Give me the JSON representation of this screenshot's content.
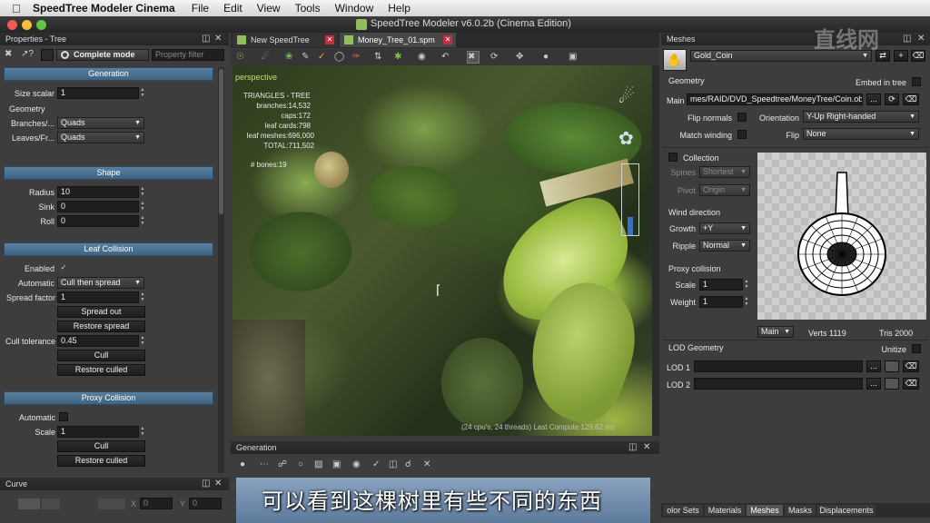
{
  "menubar": {
    "app_name": "SpeedTree Modeler Cinema",
    "items": [
      "File",
      "Edit",
      "View",
      "Tools",
      "Window",
      "Help"
    ]
  },
  "window": {
    "title": "SpeedTree Modeler v6.0.2b (Cinema Edition)"
  },
  "left_panel": {
    "title": "Properties - Tree",
    "mode": "Complete mode",
    "filter_placeholder": "Property filter",
    "generation": {
      "title": "Generation",
      "size_scalar_label": "Size scalar",
      "size_scalar": "1",
      "geometry_label": "Geometry",
      "branches_label": "Branches/...",
      "branches": "Quads",
      "leaves_label": "Leaves/Fr...",
      "leaves": "Quads"
    },
    "shape": {
      "title": "Shape",
      "radius_label": "Radius",
      "radius": "10",
      "sink_label": "Sink",
      "sink": "0",
      "roll_label": "Roll",
      "roll": "0"
    },
    "leaf_collision": {
      "title": "Leaf Collision",
      "enabled_label": "Enabled",
      "enabled": "✓",
      "automatic_label": "Automatic",
      "automatic": "Cull then spread",
      "spread_factor_label": "Spread factor",
      "spread_factor": "1",
      "spread_out": "Spread out",
      "restore_spread": "Restore spread",
      "cull_tolerance_label": "Cull tolerance",
      "cull_tolerance": "0.45",
      "cull": "Cull",
      "restore_culled": "Restore culled"
    },
    "proxy_collision": {
      "title": "Proxy Collision",
      "automatic_label": "Automatic",
      "scale_label": "Scale",
      "scale": "1",
      "cull": "Cull",
      "restore_culled": "Restore culled"
    },
    "curve": {
      "title": "Curve",
      "x_label": "X",
      "x": "0",
      "y_label": "Y",
      "y": "0"
    }
  },
  "center": {
    "tabs": [
      "New SpeedTree",
      "Money_Tree_01.spm"
    ],
    "viewport_label": "perspective",
    "stats": {
      "header": "TRIANGLES - TREE",
      "lines": [
        "branches:14,532",
        "caps:172",
        "leaf cards:798",
        "leaf meshes:696,000",
        "TOTAL:711,502"
      ],
      "bones": "# bones:19"
    },
    "status": "(24 cpu's, 24 threads) Last Compute 129.62 ms",
    "generation_panel_title": "Generation"
  },
  "right_panel": {
    "title": "Meshes",
    "mesh_name": "Gold_Coin",
    "geometry_label": "Geometry",
    "embed_label": "Embed in tree",
    "main_label": "Main",
    "main_path": "mes/RAID/DVD_Speedtree/MoneyTree/Coin.obj",
    "flip_normals_label": "Flip normals",
    "orientation_label": "Orientation",
    "orientation": "Y-Up Right-handed",
    "match_winding_label": "Match winding",
    "flip_label": "Flip",
    "flip": "None",
    "collection_label": "Collection",
    "spines_label": "Spines",
    "spines": "Shortest",
    "pivot_label": "Pivot",
    "pivot": "Origin",
    "wind_label": "Wind direction",
    "growth_label": "Growth",
    "growth": "+Y",
    "ripple_label": "Ripple",
    "ripple": "Normal",
    "proxy_label": "Proxy collision",
    "proxy_scale_label": "Scale",
    "proxy_scale": "1",
    "weight_label": "Weight",
    "weight": "1",
    "preview_mode": "Main",
    "verts": "Verts 1119",
    "tris": "Tris 2000",
    "lod_label": "LOD Geometry",
    "unitize_label": "Unitize",
    "lod1_label": "LOD 1",
    "lod2_label": "LOD 2",
    "bottom_tabs": [
      "olor Sets",
      "Materials",
      "Meshes",
      "Masks",
      "Displacements"
    ]
  },
  "watermark": "直线网",
  "subtitle": "可以看到这棵树里有些不同的东西"
}
